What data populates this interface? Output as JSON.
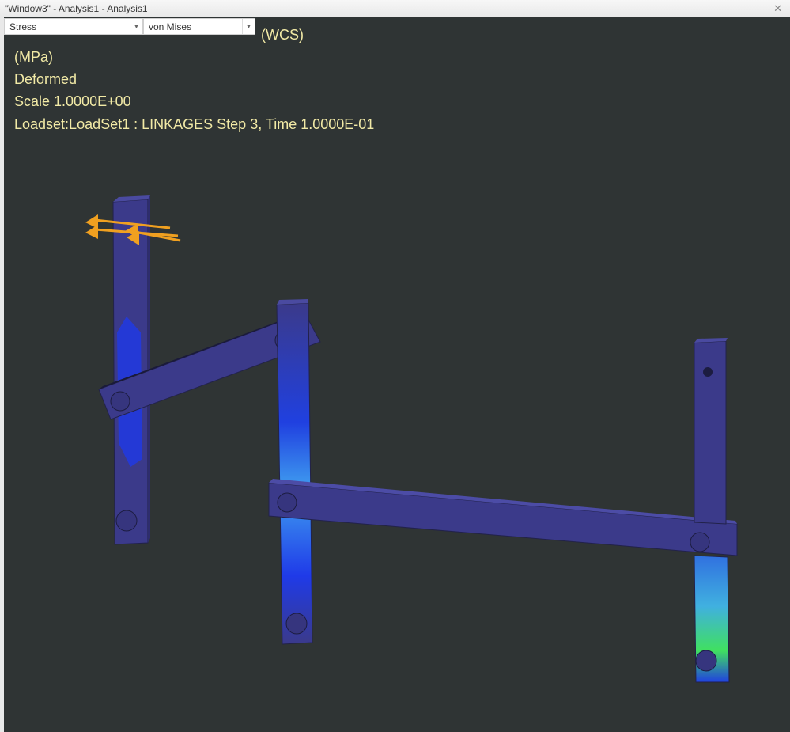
{
  "window": {
    "title": "\"Window3\" - Analysis1 - Analysis1",
    "close_icon": "close-icon"
  },
  "toolbar": {
    "quantity": {
      "value": "Stress"
    },
    "component": {
      "value": "von Mises"
    },
    "coordinate_system": "(WCS)"
  },
  "info": {
    "units": "(MPa)",
    "display": "Deformed",
    "scale": "Scale  1.0000E+00",
    "loadset": "Loadset:LoadSet1 :  LINKAGES Step 3, Time  1.0000E-01"
  },
  "colors": {
    "background": "#2f3434",
    "label": "#f2eaa6",
    "part": "#3b3a8a",
    "load_arrows": "#f0a020"
  }
}
